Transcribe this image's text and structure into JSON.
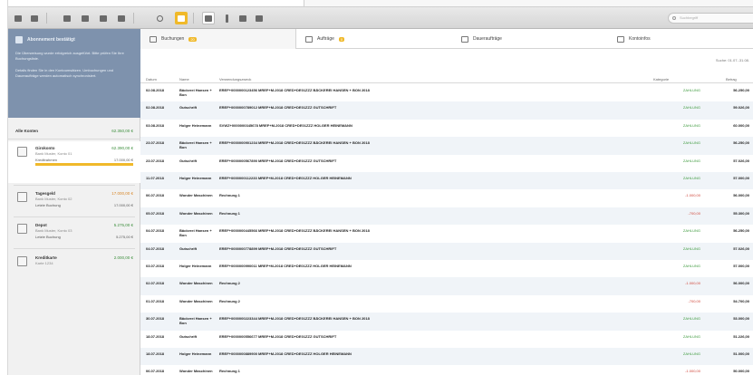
{
  "toolbar": {
    "buttons": [
      "grid-icon",
      "grid-icon",
      "card-icon",
      "card-icon",
      "card-icon",
      "card-icon",
      "refresh-icon",
      "folder-icon",
      "pen-icon",
      "mic-icon",
      "link-icon",
      "clip-icon"
    ],
    "search_placeholder": "Suchbegriff"
  },
  "sidebar": {
    "promo": {
      "title": "Abonnement bestätigt",
      "text1": "Die Überweisung wurde erfolgreich ausgeführt. Bitte prüfen Sie Ihre Buchungsliste.",
      "text2": "Details finden Sie in den Kontoumsätzen. Umbuchungen und Daueraufträge werden automatisch synchronisiert."
    },
    "accounts_header": {
      "label": "Alle Konten",
      "total": "62.350,00 €"
    },
    "accounts": [
      {
        "name": "Girokonto",
        "amount": "62.390,00 €",
        "amount_color": "green",
        "sub": "Bank Muster, Konto 01",
        "line1_l": "Kreditrahmen",
        "line1_r": "17.000,00 €",
        "bar": true
      },
      {
        "name": "Tagesgeld",
        "amount": "17.000,00 €",
        "amount_color": "orange",
        "sub": "Bank Muster, Konto 02",
        "line1_l": "Letzte Buchung",
        "line1_r": "17.000,00 €",
        "bar": false
      },
      {
        "name": "Depot",
        "amount": "5.275,00 €",
        "amount_color": "green",
        "sub": "Bank Muster, Konto 03",
        "line1_l": "Letzte Buchung",
        "line1_r": "5.275,00 €",
        "bar": false
      },
      {
        "name": "Kreditkarte",
        "amount": "2.000,00 €",
        "amount_color": "green",
        "sub": "Karte 1234",
        "line1_l": "",
        "line1_r": "",
        "bar": false
      }
    ]
  },
  "tabs": [
    {
      "label": "Buchungen",
      "badge": "20"
    },
    {
      "label": "Aufträge",
      "badge": "0"
    },
    {
      "label": "Daueraufträge",
      "badge": ""
    },
    {
      "label": "Kontoinfos",
      "badge": ""
    }
  ],
  "filter_text": "Suche: 01.07.-31.08.",
  "table": {
    "headers": [
      "Datum",
      "Name",
      "Verwendungszweck",
      "Kategorie",
      "Betrag"
    ],
    "rows": [
      {
        "date": "02.08.2018",
        "name": "Bäckerei Hansen + Bon",
        "purpose": "EREF+0000000123456 MREF+M-2018 CRED+DE01ZZZ BÄCKEREI HANSEN + BON 2018",
        "status": "ZAHLUNG",
        "status_color": "green",
        "amount": "56.250,00"
      },
      {
        "date": "02.08.2018",
        "name": "Gutschrift",
        "purpose": "EREF+0000000789012 MREF+M-2018 CRED+DE01ZZZ GUTSCHRIFT",
        "status": "ZAHLUNG",
        "status_color": "green",
        "amount": "59.026,00"
      },
      {
        "date": "03.08.2018",
        "name": "Holger Heinemann",
        "purpose": "SVWZ+0000000345678 MREF+M-2018 CRED+DE01ZZZ HOLGER HEINEMANN",
        "status": "ZAHLUNG",
        "status_color": "green",
        "amount": "60.000,00"
      },
      {
        "date": "23.07.2018",
        "name": "Bäckerei Hansen + Bon",
        "purpose": "EREF+0000000901234 MREF+M-2018 CRED+DE01ZZZ BÄCKEREI HANSEN + BON 2018",
        "status": "ZAHLUNG",
        "status_color": "green",
        "amount": "56.250,00"
      },
      {
        "date": "23.07.2018",
        "name": "Gutschrift",
        "purpose": "EREF+0000000567890 MREF+M-2018 CRED+DE01ZZZ GUTSCHRIFT",
        "status": "ZAHLUNG",
        "status_color": "green",
        "amount": "57.026,00"
      },
      {
        "date": "11.07.2018",
        "name": "Holger Heinemann",
        "purpose": "EREF+0000000112233 MREF+M-2018 CRED+DE01ZZZ HOLGER HEINEMANN",
        "status": "ZAHLUNG",
        "status_color": "green",
        "amount": "57.000,00"
      },
      {
        "date": "06.07.2018",
        "name": "Wonder Maschinen",
        "purpose": "Rechnung 1",
        "status": "-1.000,00",
        "status_color": "red",
        "amount": "56.000,00"
      },
      {
        "date": "05.07.2018",
        "name": "Wonder Maschinen",
        "purpose": "Rechnung 1",
        "status": "-700,00",
        "status_color": "red",
        "amount": "55.300,00"
      },
      {
        "date": "04.07.2018",
        "name": "Bäckerei Hansen + Bon",
        "purpose": "EREF+0000000445566 MREF+M-2018 CRED+DE01ZZZ BÄCKEREI HANSEN + BON 2018",
        "status": "ZAHLUNG",
        "status_color": "green",
        "amount": "56.250,00"
      },
      {
        "date": "04.07.2018",
        "name": "Gutschrift",
        "purpose": "EREF+0000000778899 MREF+M-2018 CRED+DE01ZZZ GUTSCHRIFT",
        "status": "ZAHLUNG",
        "status_color": "green",
        "amount": "57.026,00"
      },
      {
        "date": "03.07.2018",
        "name": "Holger Heinemann",
        "purpose": "EREF+0000000990011 MREF+M-2018 CRED+DE01ZZZ HOLGER HEINEMANN",
        "status": "ZAHLUNG",
        "status_color": "green",
        "amount": "57.000,00"
      },
      {
        "date": "02.07.2018",
        "name": "Wonder Maschinen",
        "purpose": "Rechnung 2",
        "status": "-1.000,00",
        "status_color": "red",
        "amount": "56.000,00"
      },
      {
        "date": "01.07.2018",
        "name": "Wonder Maschinen",
        "purpose": "Rechnung 2",
        "status": "-700,00",
        "status_color": "red",
        "amount": "54.700,00"
      },
      {
        "date": "30.07.2018",
        "name": "Bäckerei Hansen + Bon",
        "purpose": "EREF+0000000223344 MREF+M-2018 CRED+DE01ZZZ BÄCKEREI HANSEN + BON 2018",
        "status": "ZAHLUNG",
        "status_color": "green",
        "amount": "53.000,00"
      },
      {
        "date": "18.07.2018",
        "name": "Gutschrift",
        "purpose": "EREF+0000000556677 MREF+M-2018 CRED+DE01ZZZ GUTSCHRIFT",
        "status": "ZAHLUNG",
        "status_color": "green",
        "amount": "51.226,00"
      },
      {
        "date": "18.07.2018",
        "name": "Holger Heinemann",
        "purpose": "EREF+0000000889900 MREF+M-2018 CRED+DE01ZZZ HOLGER HEINEMANN",
        "status": "ZAHLUNG",
        "status_color": "green",
        "amount": "51.000,00"
      },
      {
        "date": "06.07.2018",
        "name": "Wonder Maschinen",
        "purpose": "Rechnung 1",
        "status": "-1.000,00",
        "status_color": "red",
        "amount": "50.000,00"
      }
    ]
  }
}
